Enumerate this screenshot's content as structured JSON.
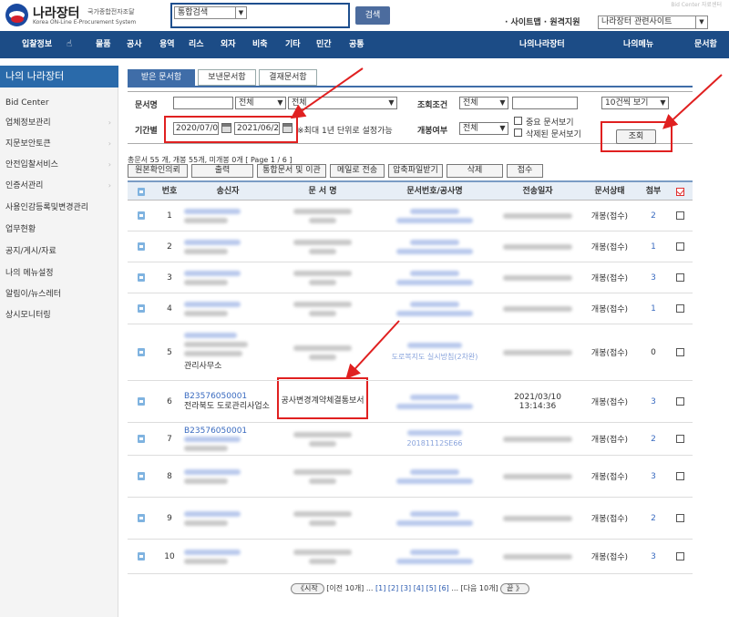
{
  "header": {
    "logo_name": "나라장터",
    "logo_tag": "국가종합전자조달",
    "logo_sub": "Korea ON-Line E-Procurement System",
    "search_select": "통합검색",
    "search_button": "검색",
    "top_links": "Bid Center 자료센터",
    "site_links_prefix": "· 사이트맵 · 원격지원",
    "related_select": "나라장터 관련사이트"
  },
  "nav": [
    "입찰정보",
    "물품",
    "공사",
    "용역",
    "리스",
    "외자",
    "비축",
    "기타",
    "민간",
    "공통",
    "나의나라장터",
    "나의메뉴",
    "문서함"
  ],
  "sidebar": {
    "title": "나의 나라장터",
    "items": [
      {
        "label": "Bid Center",
        "chev": false
      },
      {
        "label": "업체정보관리",
        "chev": true
      },
      {
        "label": "지문보안토큰",
        "chev": true
      },
      {
        "label": "안전입찰서비스",
        "chev": true
      },
      {
        "label": "인증서관리",
        "chev": true
      },
      {
        "label": "사용인감등록및변경관리",
        "chev": false
      },
      {
        "label": "업무현황",
        "chev": false
      },
      {
        "label": "공지/게시/자료",
        "chev": false
      },
      {
        "label": "나의 메뉴설정",
        "chev": false
      },
      {
        "label": "알림이/뉴스레터",
        "chev": false
      },
      {
        "label": "상시모니터링",
        "chev": false
      }
    ]
  },
  "tabs": [
    "받은 문서함",
    "보낸문서함",
    "결재문서함"
  ],
  "filter": {
    "doc_name_label": "문서명",
    "doc_name_value": "",
    "scope_select1": "전체",
    "scope_select2": "전체",
    "condition_label": "조회조건",
    "condition_select": "전체",
    "condition_value": "",
    "page_size_select": "10건씩 보기",
    "period_label": "기간별",
    "date_from": "2020/07/01",
    "date_to": "2021/06/28",
    "period_note": "※최대 1년 단위로 설정가능",
    "open_label": "개봉여부",
    "open_select": "전체",
    "important_docs": "중요 문서보기",
    "deleted_docs": "삭제된 문서보기",
    "query_button": "조회"
  },
  "summary": "총문서 55 개, 개봉 55개, 미개봉 0개 [ Page 1 / 6 ]",
  "actions": [
    "원본확인의뢰",
    "출력",
    "통합문서 및 이관",
    "메일로 전송",
    "압축파일받기",
    "삭제",
    "접수"
  ],
  "table": {
    "headers": [
      "번호",
      "송신자",
      "문 서 명",
      "문서번호/공사명",
      "전송일자",
      "문서상태",
      "첨부"
    ],
    "rows": [
      {
        "no": "1",
        "sender": "",
        "sender_bid": "",
        "title": "",
        "docno": "",
        "date": "",
        "status": "개봉(접수)",
        "attach": "2"
      },
      {
        "no": "2",
        "sender": "",
        "sender_bid": "",
        "title": "",
        "docno": "",
        "date": "",
        "status": "개봉(접수)",
        "attach": "1"
      },
      {
        "no": "3",
        "sender": "",
        "sender_bid": "",
        "title": "",
        "docno": "",
        "date": "",
        "status": "개봉(접수)",
        "attach": "3"
      },
      {
        "no": "4",
        "sender": "",
        "sender_bid": "",
        "title": "",
        "docno": "",
        "date": "",
        "status": "개봉(접수)",
        "attach": "1"
      },
      {
        "no": "5",
        "sender": "관리사무소",
        "sender_bid": "",
        "title": "",
        "docno": "도로복지도 실시방침(2차완)",
        "date": "",
        "status": "개봉(접수)",
        "attach": "0"
      },
      {
        "no": "6",
        "sender": "전라북도 도로관리사업소",
        "sender_bid": "B23576050001",
        "title": "공사변경계약체결통보서",
        "docno": "",
        "date": "2021/03/10 13:14:36",
        "status": "개봉(접수)",
        "attach": "3"
      },
      {
        "no": "7",
        "sender": "",
        "sender_bid": "B23576050001",
        "title": "",
        "docno": "20181112SE66",
        "date": "",
        "status": "개봉(접수)",
        "attach": "2"
      },
      {
        "no": "8",
        "sender": "",
        "sender_bid": "",
        "title": "",
        "docno": "",
        "date": "",
        "status": "개봉(접수)",
        "attach": "3"
      },
      {
        "no": "9",
        "sender": "",
        "sender_bid": "",
        "title": "",
        "docno": "",
        "date": "",
        "status": "개봉(접수)",
        "attach": "2"
      },
      {
        "no": "10",
        "sender": "",
        "sender_bid": "",
        "title": "",
        "docno": "",
        "date": "",
        "status": "개봉(접수)",
        "attach": "3"
      }
    ]
  },
  "pager": {
    "start": "《시작",
    "prev": "[이전 10개] ...",
    "pages": [
      "[1]",
      "[2]",
      "[3]",
      "[4]",
      "[5]",
      "[6]"
    ],
    "next": "... [다음 10개]",
    "end": "끝 》"
  },
  "colors": {
    "nav": "#1c4c86",
    "accent": "#3f6da8",
    "highlight": "#e02020"
  }
}
